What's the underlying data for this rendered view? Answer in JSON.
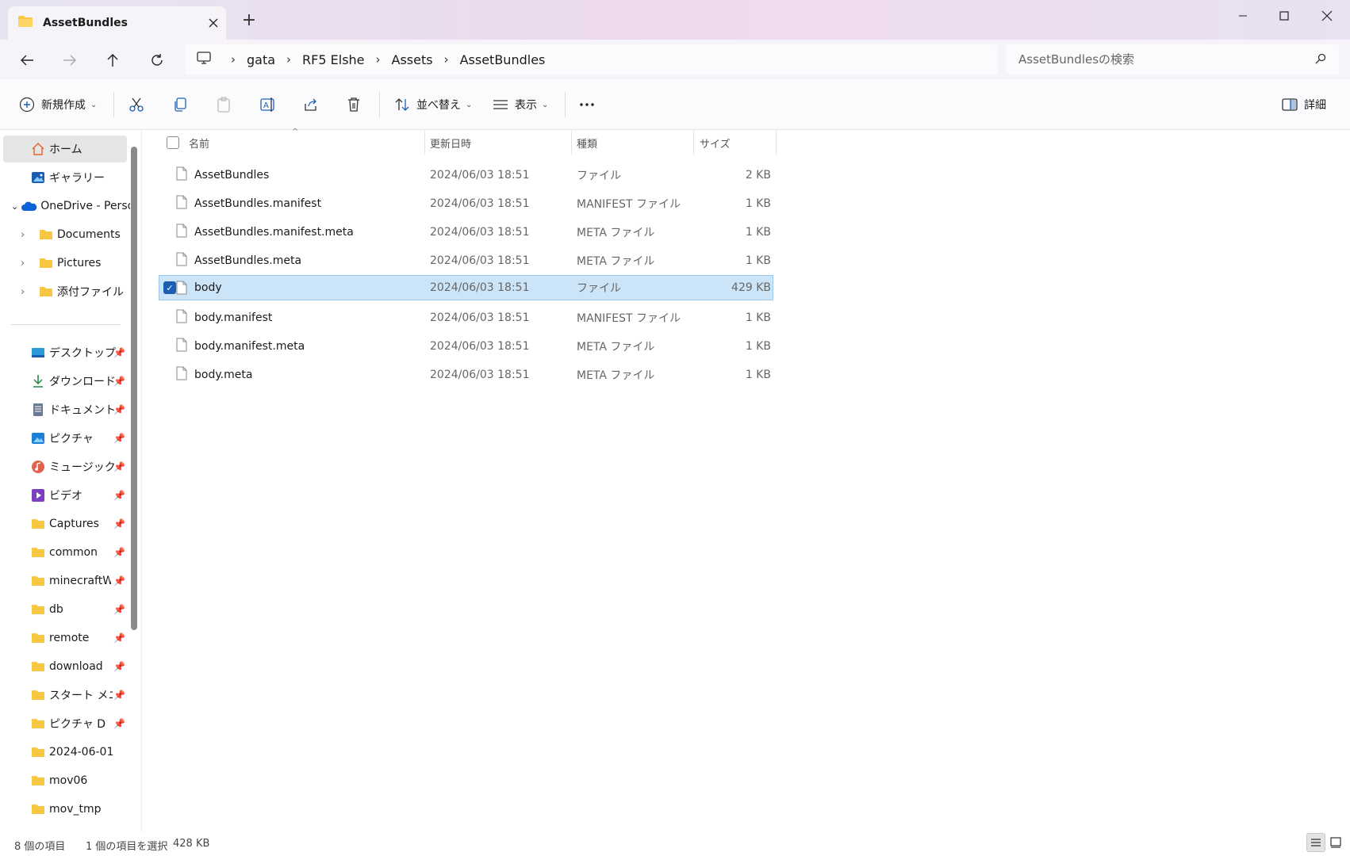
{
  "window": {
    "tab_title": "AssetBundles",
    "newtab_label": "+"
  },
  "nav": {
    "breadcrumb": [
      "gata",
      "RF5 Elshe",
      "Assets",
      "AssetBundles"
    ],
    "search_placeholder": "AssetBundlesの検索"
  },
  "commands": {
    "new": "新規作成",
    "sort": "並べ替え",
    "view": "表示",
    "details": "詳細"
  },
  "sidebar": {
    "items": [
      {
        "label": "ホーム",
        "icon": "home-icon"
      },
      {
        "label": "ギャラリー",
        "icon": "gallery-icon"
      },
      {
        "label": "OneDrive - Personal",
        "icon": "onedrive-icon"
      },
      {
        "label": "Documents",
        "icon": "folder-icon"
      },
      {
        "label": "Pictures",
        "icon": "folder-icon"
      },
      {
        "label": "添付ファイル",
        "icon": "folder-icon"
      }
    ],
    "pinned": [
      {
        "label": "デスクトップ",
        "icon": "desktop-icon"
      },
      {
        "label": "ダウンロード",
        "icon": "download-icon"
      },
      {
        "label": "ドキュメント",
        "icon": "document-icon"
      },
      {
        "label": "ピクチャ",
        "icon": "pictures-icon"
      },
      {
        "label": "ミュージック",
        "icon": "music-icon"
      },
      {
        "label": "ビデオ",
        "icon": "video-icon"
      },
      {
        "label": "Captures",
        "icon": "folder-icon"
      },
      {
        "label": "common",
        "icon": "folder-icon"
      },
      {
        "label": "minecraftWorlds",
        "icon": "folder-icon"
      },
      {
        "label": "db",
        "icon": "folder-icon"
      },
      {
        "label": "remote",
        "icon": "folder-icon"
      },
      {
        "label": "download",
        "icon": "folder-icon"
      },
      {
        "label": "スタート メニュー",
        "icon": "folder-icon"
      },
      {
        "label": "ピクチャ D",
        "icon": "folder-icon"
      },
      {
        "label": "2024-06-01",
        "icon": "folder-icon"
      },
      {
        "label": "mov06",
        "icon": "folder-icon"
      },
      {
        "label": "mov_tmp",
        "icon": "folder-icon"
      }
    ]
  },
  "columns": {
    "name": "名前",
    "date": "更新日時",
    "type": "種類",
    "size": "サイズ"
  },
  "files": [
    {
      "name": "AssetBundles",
      "date": "2024/06/03 18:51",
      "type": "ファイル",
      "size": "2 KB",
      "selected": false
    },
    {
      "name": "AssetBundles.manifest",
      "date": "2024/06/03 18:51",
      "type": "MANIFEST ファイル",
      "size": "1 KB",
      "selected": false
    },
    {
      "name": "AssetBundles.manifest.meta",
      "date": "2024/06/03 18:51",
      "type": "META ファイル",
      "size": "1 KB",
      "selected": false
    },
    {
      "name": "AssetBundles.meta",
      "date": "2024/06/03 18:51",
      "type": "META ファイル",
      "size": "1 KB",
      "selected": false
    },
    {
      "name": "body",
      "date": "2024/06/03 18:51",
      "type": "ファイル",
      "size": "429 KB",
      "selected": true
    },
    {
      "name": "body.manifest",
      "date": "2024/06/03 18:51",
      "type": "MANIFEST ファイル",
      "size": "1 KB",
      "selected": false
    },
    {
      "name": "body.manifest.meta",
      "date": "2024/06/03 18:51",
      "type": "META ファイル",
      "size": "1 KB",
      "selected": false
    },
    {
      "name": "body.meta",
      "date": "2024/06/03 18:51",
      "type": "META ファイル",
      "size": "1 KB",
      "selected": false
    }
  ],
  "status": {
    "count": "8 個の項目",
    "selection": "1 個の項目を選択",
    "size": "428 KB"
  },
  "colors": {
    "accent": "#1a5fb4",
    "selection": "#cce4f7",
    "folder": "#f8c640"
  }
}
